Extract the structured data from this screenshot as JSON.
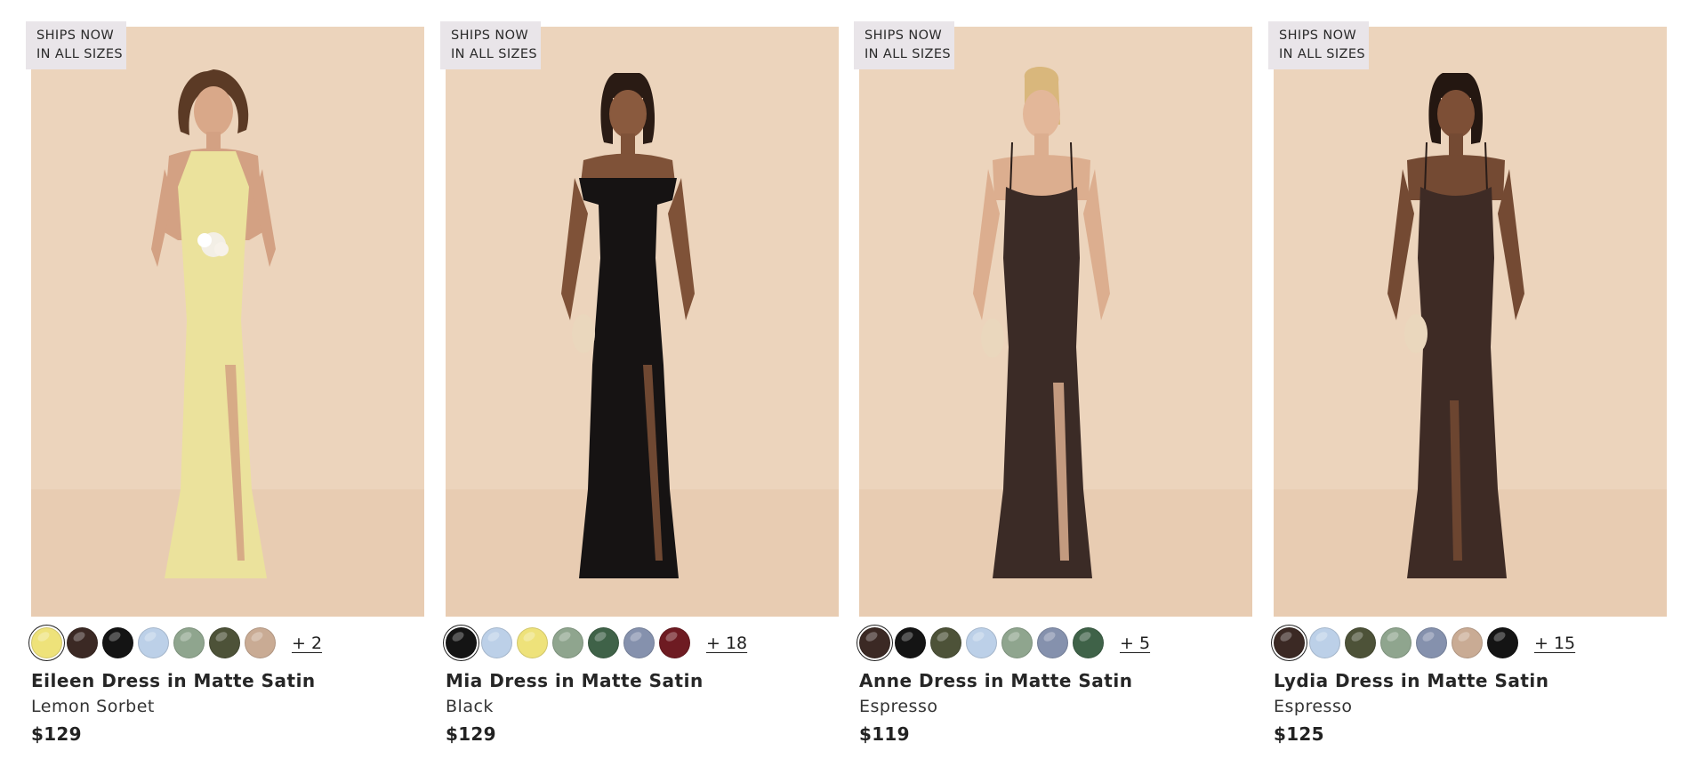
{
  "products": [
    {
      "badge_line1": "SHIPS NOW",
      "badge_line2": "IN ALL SIZES",
      "name": "Eileen Dress in Matte Satin",
      "color": "Lemon Sorbet",
      "price": "$129",
      "more_colors": "+ 2",
      "dress_color": "#ebe29c",
      "swatches": [
        "#eee27a",
        "#3b2924",
        "#141414",
        "#bcd0e8",
        "#8fa58e",
        "#4d5238",
        "#c9ab94"
      ],
      "selected_swatch": 0
    },
    {
      "badge_line1": "SHIPS NOW",
      "badge_line2": "IN ALL SIZES",
      "name": "Mia Dress in Matte Satin",
      "color": "Black",
      "price": "$129",
      "more_colors": "+ 18",
      "dress_color": "#161313",
      "swatches": [
        "#141414",
        "#bcd0e8",
        "#eee27a",
        "#8fa58e",
        "#3f6248",
        "#8591ad",
        "#6e1b22"
      ],
      "selected_swatch": 0
    },
    {
      "badge_line1": "SHIPS NOW",
      "badge_line2": "IN ALL SIZES",
      "name": "Anne Dress in Matte Satin",
      "color": "Espresso",
      "price": "$119",
      "more_colors": "+ 5",
      "dress_color": "#3b2b26",
      "swatches": [
        "#3b2924",
        "#141414",
        "#4d5238",
        "#bcd0e8",
        "#8fa58e",
        "#8591ad",
        "#3f6248"
      ],
      "selected_swatch": 0
    },
    {
      "badge_line1": "SHIPS NOW",
      "badge_line2": "IN ALL SIZES",
      "name": "Lydia Dress in Matte Satin",
      "color": "Espresso",
      "price": "$125",
      "more_colors": "+ 15",
      "dress_color": "#3e2b25",
      "swatches": [
        "#3b2924",
        "#bcd0e8",
        "#4d5238",
        "#8fa58e",
        "#8591ad",
        "#c9ab94",
        "#141414"
      ],
      "selected_swatch": 0
    }
  ]
}
